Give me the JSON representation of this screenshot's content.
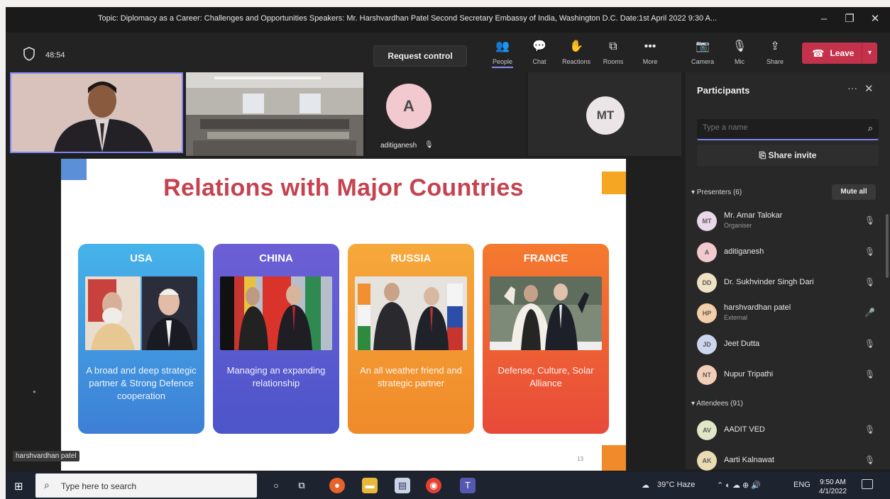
{
  "window": {
    "title": "Topic: Diplomacy as a Career: Challenges and Opportunities Speakers: Mr. Harshvardhan Patel Second Secretary Embassy of India, Washington D.C. Date:1st April 2022 9:30 A...",
    "controls": [
      "–",
      "❐",
      "✕"
    ]
  },
  "toolbar": {
    "timer": "48:54",
    "request_control": "Request control",
    "items": [
      {
        "label": "People",
        "icon": "people-icon",
        "glyph": "👥"
      },
      {
        "label": "Chat",
        "icon": "chat-icon",
        "glyph": "💬"
      },
      {
        "label": "Reactions",
        "icon": "reactions-icon",
        "glyph": "✋"
      },
      {
        "label": "Rooms",
        "icon": "rooms-icon",
        "glyph": "⧉"
      },
      {
        "label": "More",
        "icon": "more-icon",
        "glyph": "•••"
      },
      {
        "label": "Camera",
        "icon": "camera-icon",
        "glyph": "📷"
      },
      {
        "label": "Mic",
        "icon": "mic-icon",
        "glyph": "🎙"
      },
      {
        "label": "Share",
        "icon": "share-icon",
        "glyph": "⇪"
      }
    ],
    "leave": "Leave"
  },
  "tiles": {
    "aditi": {
      "initial": "A",
      "name": "aditiganesh"
    },
    "mt": {
      "initial": "MT"
    }
  },
  "slide": {
    "title": "Relations with Major Countries",
    "cards": [
      {
        "country": "USA",
        "desc": "A broad and deep strategic partner & Strong Defence cooperation",
        "color_top": "#46b3ea",
        "color_bottom": "#3d7fd6"
      },
      {
        "country": "CHINA",
        "desc": "Managing an expanding relationship",
        "color_top": "#6d5fd6",
        "color_bottom": "#4c55c9"
      },
      {
        "country": "RUSSIA",
        "desc": "An all weather friend and strategic partner",
        "color_top": "#f6a83b",
        "color_bottom": "#f08a2a"
      },
      {
        "country": "FRANCE",
        "desc": "Defense, Culture, Solar Alliance",
        "color_top": "#f47a2e",
        "color_bottom": "#e84a3a"
      }
    ],
    "page_number": "13"
  },
  "speaker_label": "harshvardhan patel",
  "participants": {
    "title": "Participants",
    "search_placeholder": "Type a name",
    "share_invite": "Share invite",
    "presenters_label": "Presenters (6)",
    "mute_all": "Mute all",
    "attendees_label": "Attendees (91)",
    "presenters": [
      {
        "initials": "MT",
        "name": "Mr. Amar Talokar",
        "role": "Organiser",
        "color": "#e9d7ea"
      },
      {
        "initials": "A",
        "name": "aditiganesh",
        "role": "",
        "color": "#f3c9d0"
      },
      {
        "initials": "DD",
        "name": "Dr. Sukhvinder Singh Dari",
        "role": "",
        "color": "#efe2c4"
      },
      {
        "initials": "HP",
        "name": "harshvardhan patel",
        "role": "External",
        "color": "#f2cfa8"
      },
      {
        "initials": "JD",
        "name": "Jeet Dutta",
        "role": "",
        "color": "#cdd6ef"
      },
      {
        "initials": "NT",
        "name": "Nupur Tripathi",
        "role": "",
        "color": "#f2cdb7"
      }
    ],
    "attendees": [
      {
        "initials": "AV",
        "name": "AADIT VED",
        "role": "",
        "color": "#dfe7c7"
      },
      {
        "initials": "AK",
        "name": "Aarti Kalnawat",
        "role": "",
        "color": "#e9dbb4"
      }
    ]
  },
  "taskbar": {
    "search_placeholder": "Type here to search",
    "weather": "39°C Haze",
    "lang": "ENG",
    "time": "9:50 AM",
    "date": "4/1/2022"
  }
}
